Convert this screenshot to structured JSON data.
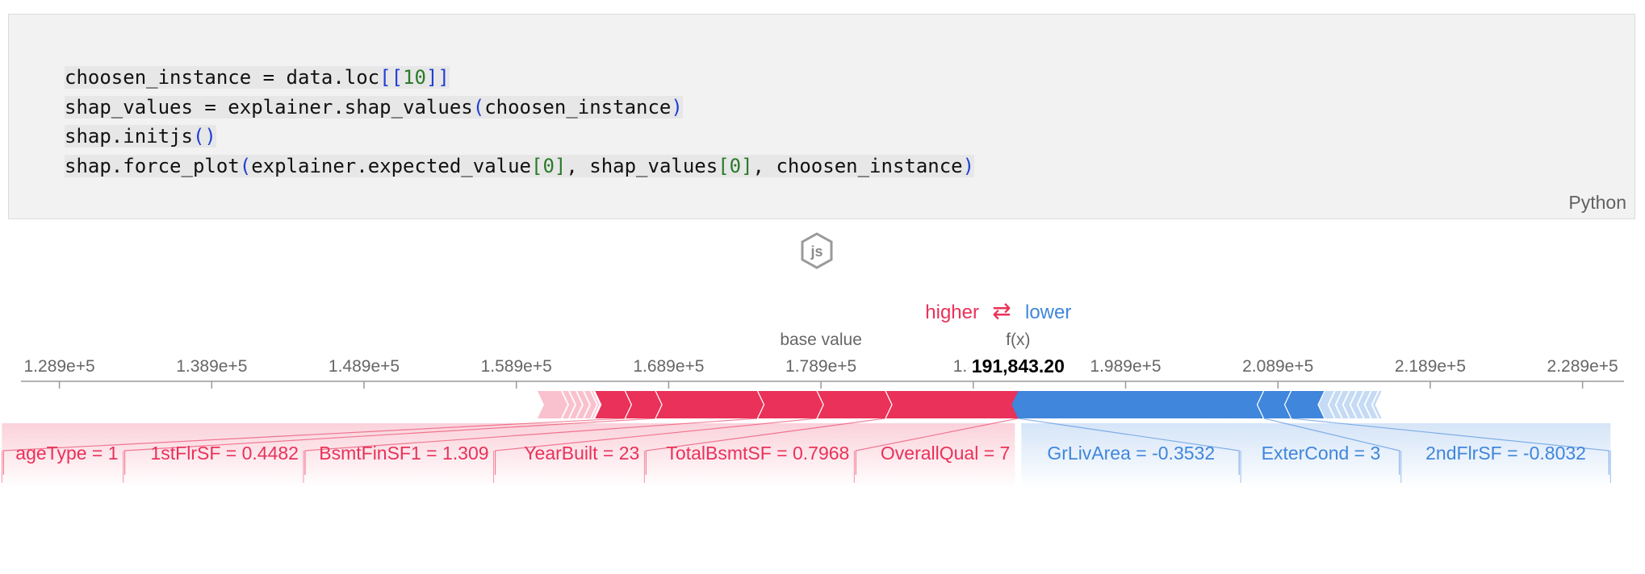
{
  "code_cell": {
    "lines": [
      [
        {
          "t": "choosen_instance = data.loc"
        },
        {
          "t": "[[",
          "c": "p"
        },
        {
          "t": "10",
          "c": "g"
        },
        {
          "t": "]]",
          "c": "p"
        }
      ],
      [
        {
          "t": "shap_values = explainer.shap_values"
        },
        {
          "t": "(",
          "c": "p"
        },
        {
          "t": "choosen_instance"
        },
        {
          "t": ")",
          "c": "p"
        }
      ],
      [
        {
          "t": "shap.initjs"
        },
        {
          "t": "()",
          "c": "p"
        }
      ],
      [
        {
          "t": "shap.force_plot"
        },
        {
          "t": "(",
          "c": "p"
        },
        {
          "t": "explainer.expected_value"
        },
        {
          "t": "[",
          "c": "g"
        },
        {
          "t": "0",
          "c": "g"
        },
        {
          "t": "]",
          "c": "g"
        },
        {
          "t": ", shap_values"
        },
        {
          "t": "[",
          "c": "g"
        },
        {
          "t": "0",
          "c": "g"
        },
        {
          "t": "]",
          "c": "g"
        },
        {
          "t": ", choosen_instance"
        },
        {
          "t": ")",
          "c": "p"
        }
      ]
    ],
    "language": "Python"
  },
  "js_badge": {
    "label": "js",
    "icon": "js-hexagon-icon"
  },
  "colors": {
    "positive": "#ea3159",
    "negative": "#3f86dc",
    "axis": "#999999",
    "text": "#666666"
  },
  "chart_data": {
    "type": "force",
    "legend": {
      "higher": "higher",
      "arrows": "⇄",
      "lower": "lower"
    },
    "base_value_label": "base value",
    "fx_label": "f(x)",
    "output_value": 191843.2,
    "output_text": "191,843.20",
    "base_value": 178900,
    "xlim": [
      125000,
      233000
    ],
    "ticks": [
      128900,
      138900,
      148900,
      158900,
      168900,
      178900,
      188900,
      198900,
      208900,
      218900,
      228900
    ],
    "tick_labels": [
      "1.289e+5",
      "1.389e+5",
      "1.489e+5",
      "1.589e+5",
      "1.689e+5",
      "1.789e+5",
      "1.8…",
      "1.989e+5",
      "2.089e+5",
      "2.189e+5",
      "2.289e+5"
    ],
    "positive_features": [
      {
        "label": "OverallQual = 7",
        "start": 183100,
        "end": 191843
      },
      {
        "label": "TotalBsmtSF = 0.7968",
        "start": 178600,
        "end": 183100
      },
      {
        "label": "YearBuilt = 23",
        "start": 174700,
        "end": 178600
      },
      {
        "label": "BsmtFinSF1 = 1.309",
        "start": 168000,
        "end": 174700
      },
      {
        "label": "1stFlrSF = 0.4482",
        "start": 166000,
        "end": 168000
      },
      {
        "label": "ageType = 1",
        "start": 164000,
        "end": 166000
      }
    ],
    "negative_features": [
      {
        "label": "GrLivArea = -0.3532",
        "start": 191843,
        "end": 208000
      },
      {
        "label": "ExterCond = 3",
        "start": 208000,
        "end": 209800
      },
      {
        "label": "2ndFlrSF = -0.8032",
        "start": 209800,
        "end": 212000
      }
    ]
  }
}
